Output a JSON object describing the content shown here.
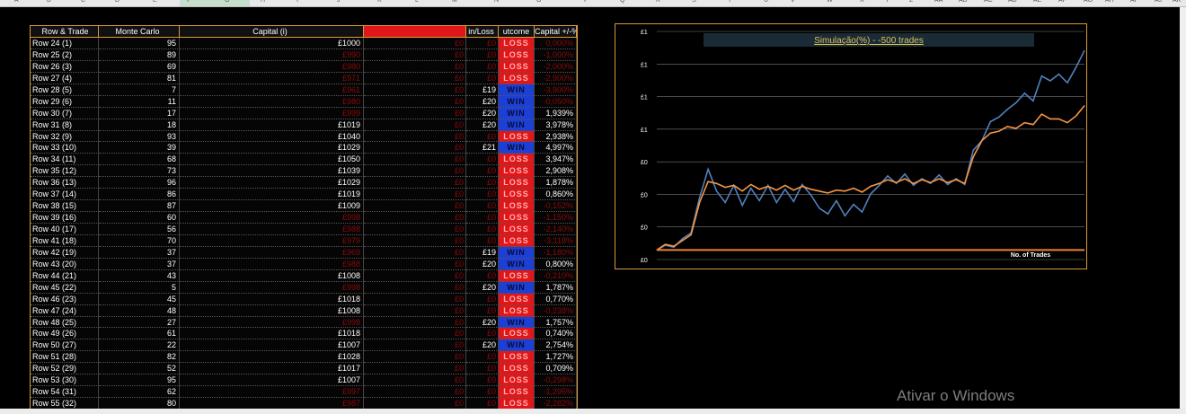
{
  "column_letters": [
    "A",
    "B",
    "C",
    "D",
    "E",
    "F",
    "G",
    "H",
    "I",
    "J",
    "K",
    "L",
    "M",
    "N",
    "O",
    "P",
    "Q",
    "R",
    "S",
    "T",
    "U",
    "V",
    "W",
    "X",
    "Y",
    "Z",
    "AA",
    "AB",
    "AC",
    "AD",
    "AE",
    "AF",
    "AG",
    "AH",
    "AI",
    "AJ",
    "AK"
  ],
  "table": {
    "headers": {
      "row_trade": "Row & Trade",
      "monte_carlo": "Monte Carlo",
      "capital": "Capital (i)",
      "blank": "",
      "win_loss": "in/Loss",
      "outcome": "utcome",
      "capital_pct": "Capital +/-%"
    },
    "rows": [
      {
        "label": "Row 24 (1)",
        "mc": "95",
        "capital": "£1000",
        "cap_dim": false,
        "stake": "£0",
        "wl": "£0",
        "wl_dim": true,
        "outcome": "LOSS",
        "pct": "0,000%",
        "pct_dim": true
      },
      {
        "label": "Row 25 (2)",
        "mc": "89",
        "capital": "£990",
        "cap_dim": true,
        "stake": "£0",
        "wl": "£0",
        "wl_dim": true,
        "outcome": "LOSS",
        "pct": "-1,000%",
        "pct_dim": true
      },
      {
        "label": "Row 26 (3)",
        "mc": "69",
        "capital": "£980",
        "cap_dim": true,
        "stake": "£0",
        "wl": "£0",
        "wl_dim": true,
        "outcome": "LOSS",
        "pct": "-2,000%",
        "pct_dim": true
      },
      {
        "label": "Row 27 (4)",
        "mc": "81",
        "capital": "£971",
        "cap_dim": true,
        "stake": "£0",
        "wl": "£0",
        "wl_dim": true,
        "outcome": "LOSS",
        "pct": "-2,900%",
        "pct_dim": true
      },
      {
        "label": "Row 28 (5)",
        "mc": "7",
        "capital": "£961",
        "cap_dim": true,
        "stake": "£0",
        "wl": "£19",
        "wl_dim": false,
        "outcome": "WIN",
        "pct": "-3,900%",
        "pct_dim": true
      },
      {
        "label": "Row 29 (6)",
        "mc": "11",
        "capital": "£980",
        "cap_dim": true,
        "stake": "£0",
        "wl": "£20",
        "wl_dim": false,
        "outcome": "WIN",
        "pct": "-0,050%",
        "pct_dim": true
      },
      {
        "label": "Row 30 (7)",
        "mc": "17",
        "capital": "£999",
        "cap_dim": true,
        "stake": "£0",
        "wl": "£20",
        "wl_dim": false,
        "outcome": "WIN",
        "pct": "1,939%",
        "pct_dim": false
      },
      {
        "label": "Row 31 (8)",
        "mc": "18",
        "capital": "£1019",
        "cap_dim": false,
        "stake": "£0",
        "wl": "£20",
        "wl_dim": false,
        "outcome": "WIN",
        "pct": "3,978%",
        "pct_dim": false
      },
      {
        "label": "Row 32 (9)",
        "mc": "93",
        "capital": "£1040",
        "cap_dim": false,
        "stake": "£0",
        "wl": "£0",
        "wl_dim": true,
        "outcome": "LOSS",
        "pct": "2,938%",
        "pct_dim": false
      },
      {
        "label": "Row 33 (10)",
        "mc": "39",
        "capital": "£1029",
        "cap_dim": false,
        "stake": "£0",
        "wl": "£21",
        "wl_dim": false,
        "outcome": "WIN",
        "pct": "4,997%",
        "pct_dim": false
      },
      {
        "label": "Row 34 (11)",
        "mc": "68",
        "capital": "£1050",
        "cap_dim": false,
        "stake": "£0",
        "wl": "£0",
        "wl_dim": true,
        "outcome": "LOSS",
        "pct": "3,947%",
        "pct_dim": false
      },
      {
        "label": "Row 35 (12)",
        "mc": "73",
        "capital": "£1039",
        "cap_dim": false,
        "stake": "£0",
        "wl": "£0",
        "wl_dim": true,
        "outcome": "LOSS",
        "pct": "2,908%",
        "pct_dim": false
      },
      {
        "label": "Row 36 (13)",
        "mc": "96",
        "capital": "£1029",
        "cap_dim": false,
        "stake": "£0",
        "wl": "£0",
        "wl_dim": true,
        "outcome": "LOSS",
        "pct": "1,878%",
        "pct_dim": false
      },
      {
        "label": "Row 37 (14)",
        "mc": "86",
        "capital": "£1019",
        "cap_dim": false,
        "stake": "£0",
        "wl": "£0",
        "wl_dim": true,
        "outcome": "LOSS",
        "pct": "0,860%",
        "pct_dim": false
      },
      {
        "label": "Row 38 (15)",
        "mc": "87",
        "capital": "£1009",
        "cap_dim": false,
        "stake": "£0",
        "wl": "£0",
        "wl_dim": true,
        "outcome": "LOSS",
        "pct": "-0,152%",
        "pct_dim": true
      },
      {
        "label": "Row 39 (16)",
        "mc": "60",
        "capital": "£998",
        "cap_dim": true,
        "stake": "£0",
        "wl": "£0",
        "wl_dim": true,
        "outcome": "LOSS",
        "pct": "-1,150%",
        "pct_dim": true
      },
      {
        "label": "Row 40 (17)",
        "mc": "56",
        "capital": "£988",
        "cap_dim": true,
        "stake": "£0",
        "wl": "£0",
        "wl_dim": true,
        "outcome": "LOSS",
        "pct": "-2,140%",
        "pct_dim": true
      },
      {
        "label": "Row 41 (18)",
        "mc": "70",
        "capital": "£979",
        "cap_dim": true,
        "stake": "£0",
        "wl": "£0",
        "wl_dim": true,
        "outcome": "LOSS",
        "pct": "-3,118%",
        "pct_dim": true
      },
      {
        "label": "Row 42 (19)",
        "mc": "37",
        "capital": "£969",
        "cap_dim": true,
        "stake": "£0",
        "wl": "£19",
        "wl_dim": false,
        "outcome": "WIN",
        "pct": "-1,180%",
        "pct_dim": true
      },
      {
        "label": "Row 43 (20)",
        "mc": "37",
        "capital": "£988",
        "cap_dim": true,
        "stake": "£0",
        "wl": "£20",
        "wl_dim": false,
        "outcome": "WIN",
        "pct": "0,800%",
        "pct_dim": false
      },
      {
        "label": "Row 44 (21)",
        "mc": "43",
        "capital": "£1008",
        "cap_dim": false,
        "stake": "£0",
        "wl": "£0",
        "wl_dim": true,
        "outcome": "LOSS",
        "pct": "-0,210%",
        "pct_dim": true
      },
      {
        "label": "Row 45 (22)",
        "mc": "5",
        "capital": "£998",
        "cap_dim": true,
        "stake": "£0",
        "wl": "£20",
        "wl_dim": false,
        "outcome": "WIN",
        "pct": "1,787%",
        "pct_dim": false
      },
      {
        "label": "Row 46 (23)",
        "mc": "45",
        "capital": "£1018",
        "cap_dim": false,
        "stake": "£0",
        "wl": "£0",
        "wl_dim": true,
        "outcome": "LOSS",
        "pct": "0,770%",
        "pct_dim": false
      },
      {
        "label": "Row 47 (24)",
        "mc": "48",
        "capital": "£1008",
        "cap_dim": false,
        "stake": "£0",
        "wl": "£0",
        "wl_dim": true,
        "outcome": "LOSS",
        "pct": "-0,238%",
        "pct_dim": true
      },
      {
        "label": "Row 48 (25)",
        "mc": "27",
        "capital": "£998",
        "cap_dim": true,
        "stake": "£0",
        "wl": "£20",
        "wl_dim": false,
        "outcome": "WIN",
        "pct": "1,757%",
        "pct_dim": false
      },
      {
        "label": "Row 49 (26)",
        "mc": "61",
        "capital": "£1018",
        "cap_dim": false,
        "stake": "£0",
        "wl": "£0",
        "wl_dim": true,
        "outcome": "LOSS",
        "pct": "0,740%",
        "pct_dim": false
      },
      {
        "label": "Row 50 (27)",
        "mc": "22",
        "capital": "£1007",
        "cap_dim": false,
        "stake": "£0",
        "wl": "£20",
        "wl_dim": false,
        "outcome": "WIN",
        "pct": "2,754%",
        "pct_dim": false
      },
      {
        "label": "Row 51 (28)",
        "mc": "82",
        "capital": "£1028",
        "cap_dim": false,
        "stake": "£0",
        "wl": "£0",
        "wl_dim": true,
        "outcome": "LOSS",
        "pct": "1,727%",
        "pct_dim": false
      },
      {
        "label": "Row 52 (29)",
        "mc": "52",
        "capital": "£1017",
        "cap_dim": false,
        "stake": "£0",
        "wl": "£0",
        "wl_dim": true,
        "outcome": "LOSS",
        "pct": "0,709%",
        "pct_dim": false
      },
      {
        "label": "Row 53 (30)",
        "mc": "95",
        "capital": "£1007",
        "cap_dim": false,
        "stake": "£0",
        "wl": "£0",
        "wl_dim": true,
        "outcome": "LOSS",
        "pct": "-0,298%",
        "pct_dim": true
      },
      {
        "label": "Row 54 (31)",
        "mc": "62",
        "capital": "£997",
        "cap_dim": true,
        "stake": "£0",
        "wl": "£0",
        "wl_dim": true,
        "outcome": "LOSS",
        "pct": "-1,295%",
        "pct_dim": true
      },
      {
        "label": "Row 55 (32)",
        "mc": "80",
        "capital": "£987",
        "cap_dim": true,
        "stake": "£0",
        "wl": "£0",
        "wl_dim": true,
        "outcome": "LOSS",
        "pct": "-2,282%",
        "pct_dim": true
      }
    ]
  },
  "chart_data": {
    "type": "line",
    "title": "Simulação(%) - -500 trades",
    "xlabel": "No. of Trades",
    "ylabel": "",
    "y_tick_labels": [
      "£1",
      "£1",
      "£1",
      "£1",
      "£0",
      "£0",
      "£0",
      "£0"
    ],
    "grid": true,
    "x": [
      0,
      10,
      20,
      30,
      40,
      50,
      60,
      70,
      80,
      90,
      100,
      110,
      120,
      130,
      140,
      150,
      160,
      170,
      180,
      190,
      200,
      210,
      220,
      230,
      240,
      250,
      260,
      270,
      280,
      290,
      300,
      310,
      320,
      330,
      340,
      350,
      360,
      370,
      380,
      390,
      400,
      410,
      420,
      430,
      440,
      450,
      460,
      470,
      480,
      490,
      500
    ],
    "series": [
      {
        "color": "#4f81bd",
        "values": [
          0,
          0.5,
          0.3,
          1.2,
          1.8,
          5.5,
          8.5,
          6.2,
          5.0,
          6.8,
          4.7,
          6.5,
          5.2,
          6.8,
          5.0,
          6.4,
          5.1,
          6.9,
          5.8,
          4.4,
          3.8,
          5.2,
          3.6,
          4.8,
          4.0,
          5.9,
          6.8,
          7.8,
          7.0,
          8.0,
          6.8,
          7.5,
          7.0,
          7.9,
          6.9,
          7.5,
          6.9,
          10.5,
          11.5,
          13.5,
          14.0,
          14.8,
          15.5,
          16.5,
          15.7,
          18.3,
          17.8,
          18.5,
          17.6,
          19.2,
          21.0
        ]
      },
      {
        "color": "#f79646",
        "values": [
          0,
          0.6,
          0.4,
          1.0,
          1.6,
          5.0,
          7.2,
          7.0,
          6.6,
          6.8,
          6.2,
          6.9,
          6.4,
          6.7,
          6.3,
          6.8,
          6.3,
          6.7,
          6.4,
          6.2,
          6.0,
          6.3,
          6.2,
          6.5,
          6.1,
          6.7,
          7.0,
          7.4,
          7.1,
          7.5,
          7.0,
          7.4,
          7.1,
          7.5,
          7.1,
          7.4,
          7.0,
          9.8,
          11.5,
          12.3,
          12.5,
          13.0,
          12.8,
          13.4,
          13.2,
          14.3,
          13.8,
          13.8,
          13.4,
          14.1,
          15.2
        ]
      },
      {
        "color": "#f08030",
        "values": [
          0,
          0,
          0,
          0,
          0,
          0,
          0,
          0,
          0,
          0,
          0,
          0,
          0,
          0,
          0,
          0,
          0,
          0,
          0,
          0,
          0,
          0,
          0,
          0,
          0,
          0,
          0,
          0,
          0,
          0,
          0,
          0,
          0,
          0,
          0,
          0,
          0,
          0,
          0,
          0,
          0,
          0,
          0,
          0,
          0,
          0,
          0,
          0,
          0,
          0,
          0
        ]
      }
    ],
    "ylim": [
      -1,
      23
    ]
  },
  "watermark": "Ativar o Windows"
}
